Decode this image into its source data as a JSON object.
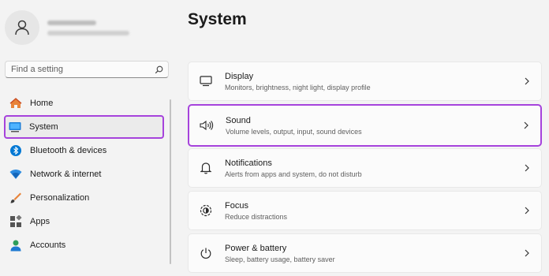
{
  "search": {
    "placeholder": "Find a setting"
  },
  "sidebar": {
    "items": [
      {
        "label": "Home",
        "icon": "home-icon"
      },
      {
        "label": "System",
        "icon": "system-icon",
        "selected": true
      },
      {
        "label": "Bluetooth & devices",
        "icon": "bluetooth-icon"
      },
      {
        "label": "Network & internet",
        "icon": "network-icon"
      },
      {
        "label": "Personalization",
        "icon": "personalization-icon"
      },
      {
        "label": "Apps",
        "icon": "apps-icon"
      },
      {
        "label": "Accounts",
        "icon": "accounts-icon"
      }
    ]
  },
  "main": {
    "title": "System",
    "cards": [
      {
        "title": "Display",
        "subtitle": "Monitors, brightness, night light, display profile",
        "icon": "monitor-icon"
      },
      {
        "title": "Sound",
        "subtitle": "Volume levels, output, input, sound devices",
        "icon": "speaker-icon",
        "highlighted": true
      },
      {
        "title": "Notifications",
        "subtitle": "Alerts from apps and system, do not disturb",
        "icon": "bell-icon"
      },
      {
        "title": "Focus",
        "subtitle": "Reduce distractions",
        "icon": "focus-icon"
      },
      {
        "title": "Power & battery",
        "subtitle": "Sleep, battery usage, battery saver",
        "icon": "power-icon"
      }
    ]
  },
  "colors": {
    "highlight": "#a643dc",
    "accent": "#0067c0"
  }
}
